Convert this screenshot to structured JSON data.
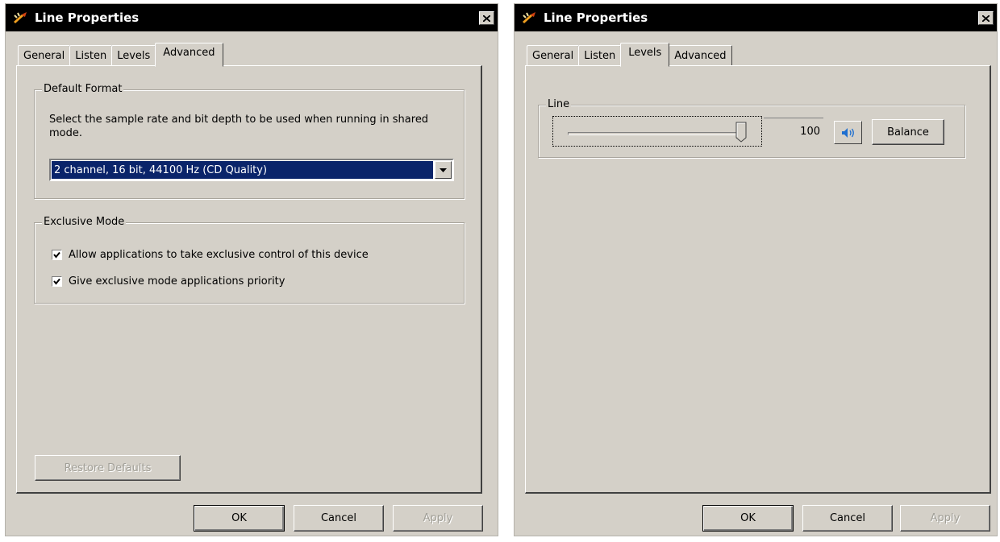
{
  "dialogs": [
    {
      "title": "Line Properties",
      "tabs": [
        {
          "label": "General"
        },
        {
          "label": "Listen"
        },
        {
          "label": "Levels"
        },
        {
          "label": "Advanced"
        }
      ],
      "active_tab": "Advanced",
      "default_format": {
        "group_label": "Default Format",
        "description": "Select the sample rate and bit depth to be used when running in shared mode.",
        "selected_value": "2 channel, 16 bit, 44100 Hz (CD Quality)"
      },
      "exclusive_mode": {
        "group_label": "Exclusive Mode",
        "options": [
          {
            "label": "Allow applications to take exclusive control of this device",
            "checked": true
          },
          {
            "label": "Give exclusive mode applications priority",
            "checked": true
          }
        ]
      },
      "restore_defaults_label": "Restore Defaults",
      "buttons": {
        "ok": "OK",
        "cancel": "Cancel",
        "apply": "Apply"
      }
    },
    {
      "title": "Line Properties",
      "tabs": [
        {
          "label": "General"
        },
        {
          "label": "Listen"
        },
        {
          "label": "Levels"
        },
        {
          "label": "Advanced"
        }
      ],
      "active_tab": "Levels",
      "levels": {
        "group_label": "Line",
        "level_value": "100",
        "slider_fraction": 1.0,
        "balance_label": "Balance"
      },
      "buttons": {
        "ok": "OK",
        "cancel": "Cancel",
        "apply": "Apply"
      }
    }
  ],
  "colors": {
    "face": "#d4d0c8",
    "titlebar": "#000000",
    "selection": "#0a246a",
    "speaker_icon": "#1e6fd0",
    "disabled_text": "#a19f97"
  },
  "icons": [
    "app-icon",
    "close-icon",
    "dropdown-arrow-icon",
    "checkmark-icon",
    "speaker-icon"
  ]
}
